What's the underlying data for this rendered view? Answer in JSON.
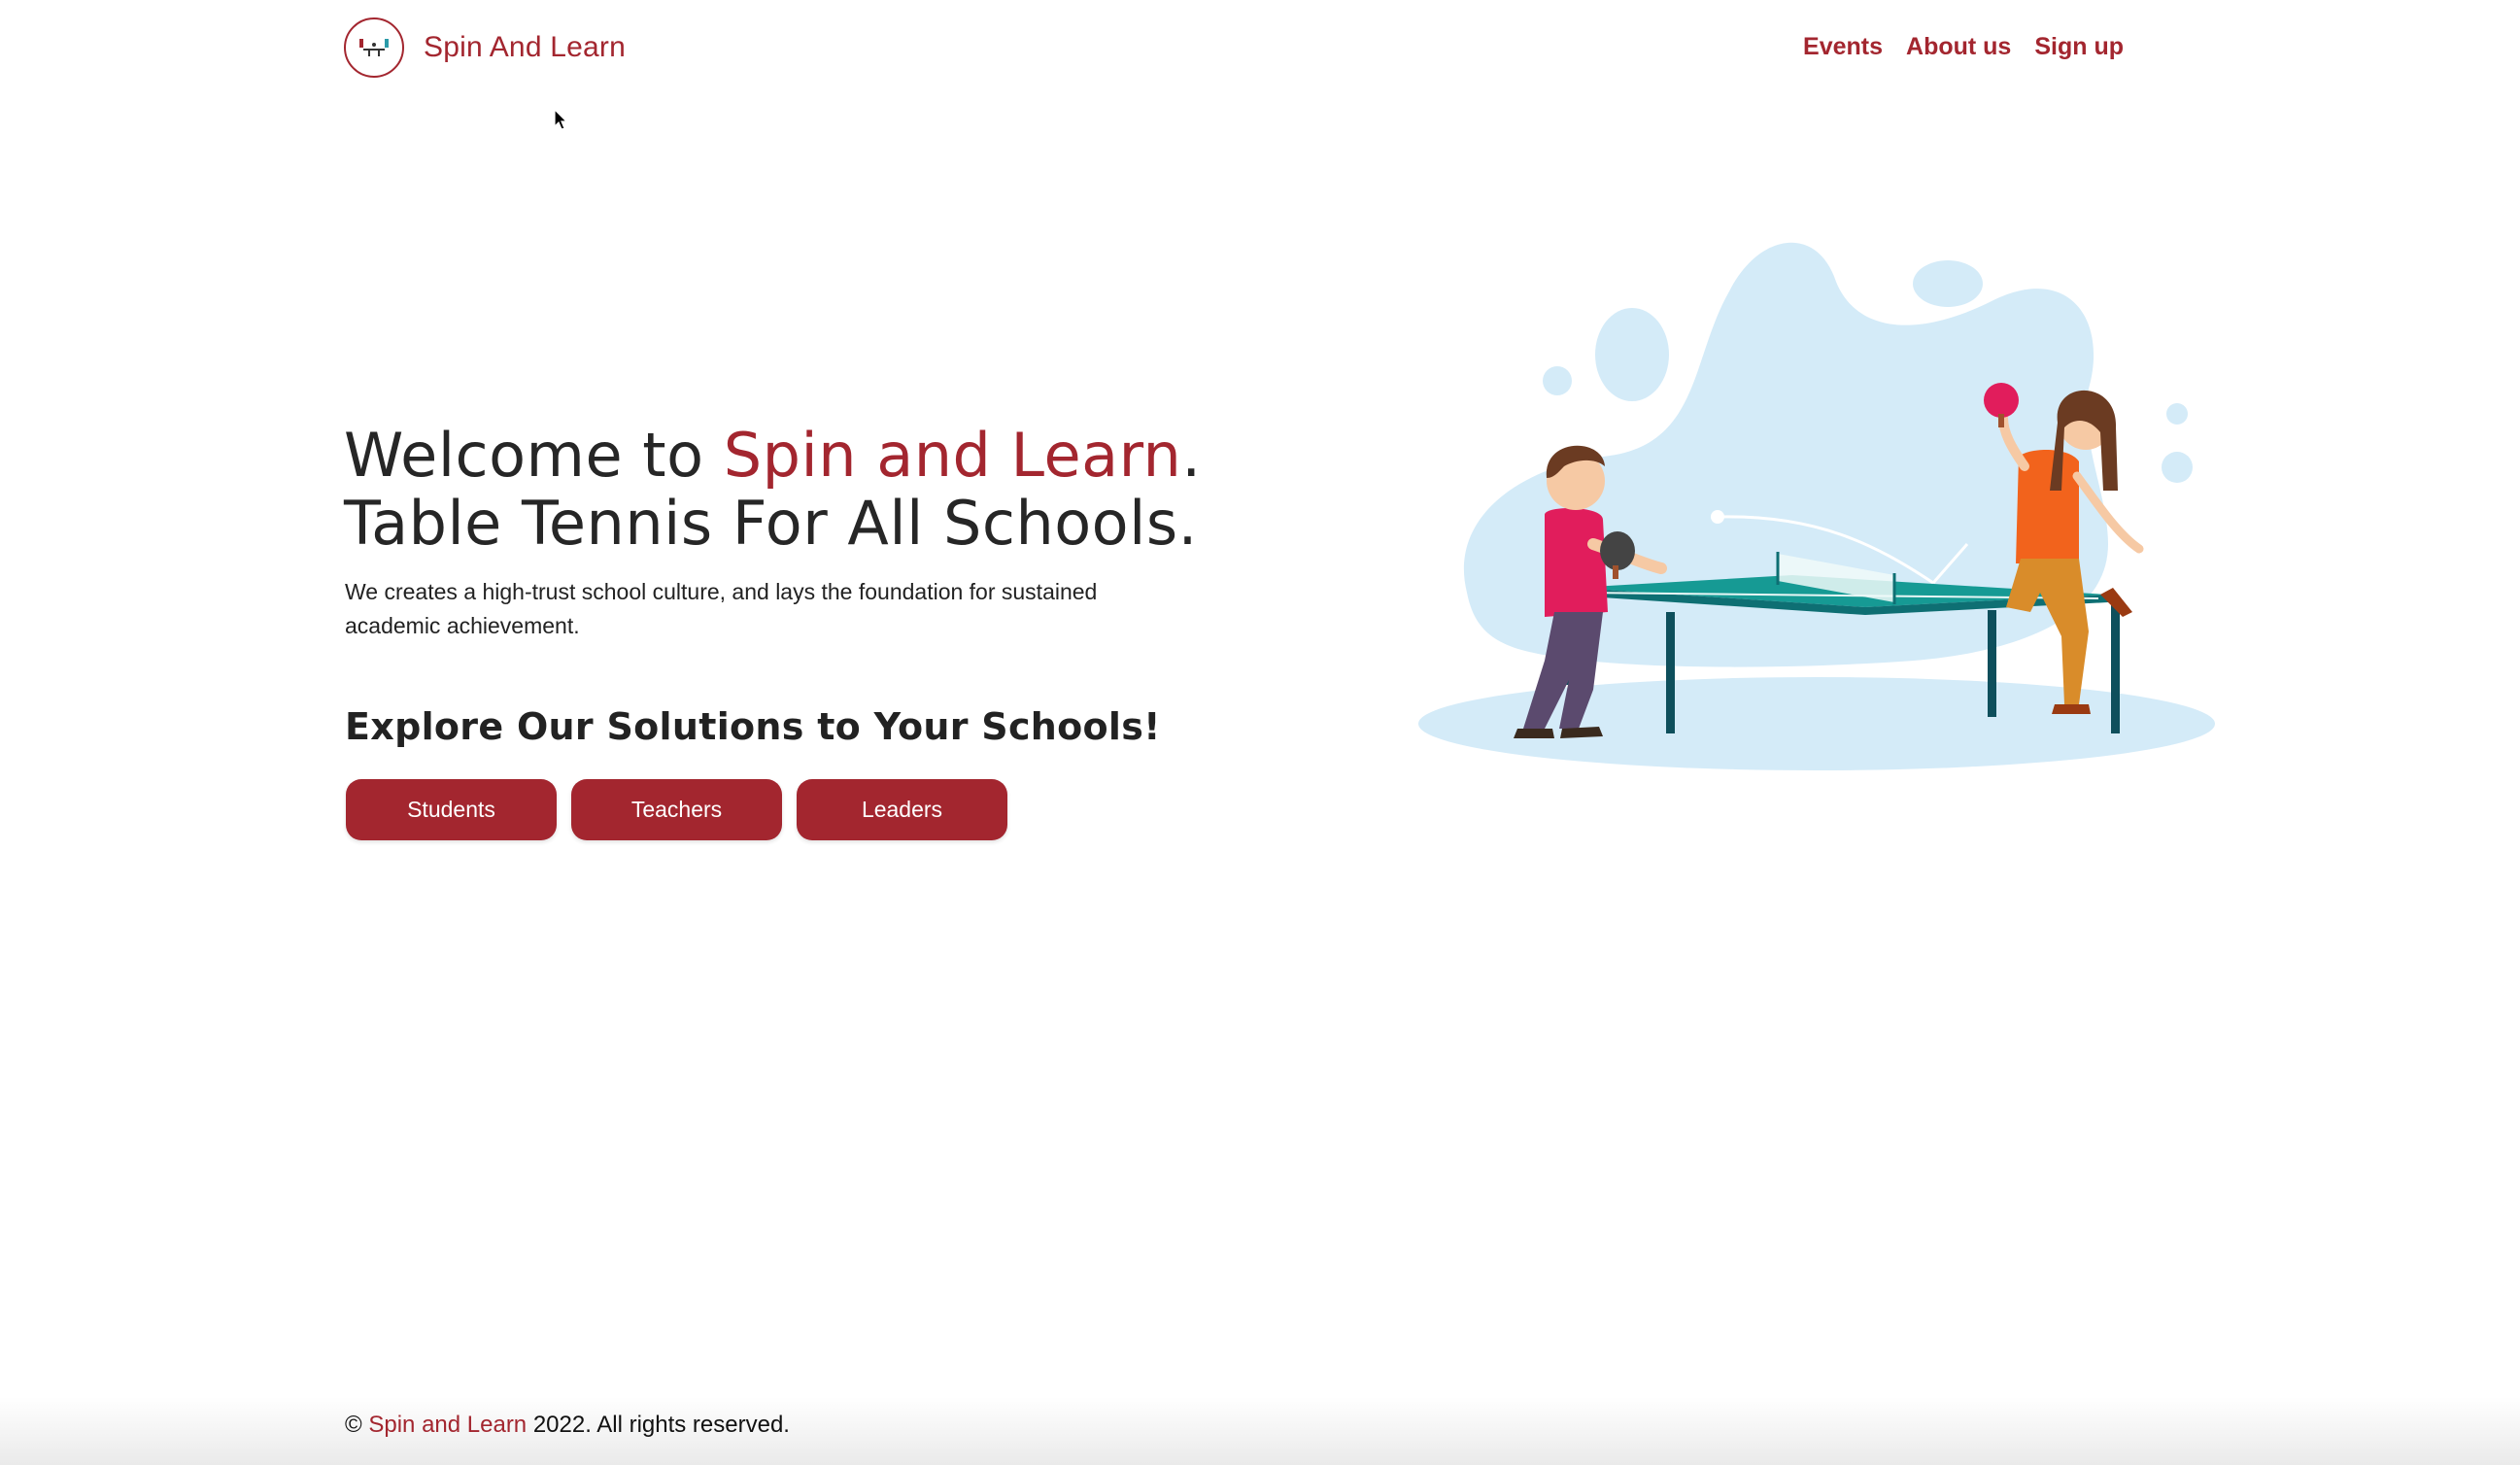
{
  "header": {
    "brand": "Spin And Learn",
    "logo_icon": "ping-pong-logo-icon",
    "nav": [
      "Events",
      "About us",
      "Sign up"
    ]
  },
  "hero": {
    "title_prefix": "Welcome to ",
    "title_accent": "Spin and Learn",
    "title_suffix": ".",
    "title_line2": "Table Tennis For All Schools.",
    "subtitle": "We creates a high-trust school culture, and lays the foundation for sustained academic achievement.",
    "explore": "Explore Our Solutions to Your Schools!",
    "buttons": [
      "Students",
      "Teachers",
      "Leaders"
    ]
  },
  "illustration": {
    "icon": "table-tennis-players-illustration"
  },
  "footer": {
    "copyright_symbol": "©",
    "brand": "Spin and Learn",
    "text": "2022. All rights reserved."
  },
  "colors": {
    "accent": "#a3262f",
    "blob": "#d4ebf8",
    "table": "#169a94"
  }
}
